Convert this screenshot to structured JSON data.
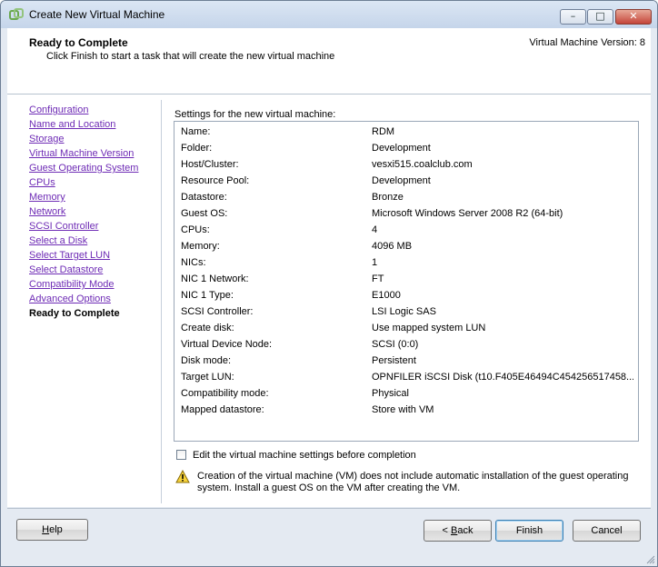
{
  "window": {
    "title": "Create New Virtual Machine",
    "buttons": {
      "minimize": "–",
      "maximize": "□",
      "close": "✕"
    }
  },
  "header": {
    "title": "Ready to Complete",
    "subtitle": "Click Finish to start a task that will create the new virtual machine",
    "version": "Virtual Machine Version: 8"
  },
  "nav": {
    "items": [
      {
        "label": "Configuration"
      },
      {
        "label": "Name and Location"
      },
      {
        "label": "Storage"
      },
      {
        "label": "Virtual Machine Version"
      },
      {
        "label": "Guest Operating System"
      },
      {
        "label": "CPUs"
      },
      {
        "label": "Memory"
      },
      {
        "label": "Network"
      },
      {
        "label": "SCSI Controller"
      },
      {
        "label": "Select a Disk"
      },
      {
        "label": "Select Target LUN"
      },
      {
        "label": "Select Datastore"
      },
      {
        "label": "Compatibility Mode"
      },
      {
        "label": "Advanced Options"
      },
      {
        "label": "Ready to Complete"
      }
    ],
    "current_index": 14
  },
  "settings": {
    "label": "Settings for the new virtual machine:",
    "rows": [
      {
        "key": "Name:",
        "value": "RDM"
      },
      {
        "key": "Folder:",
        "value": "Development"
      },
      {
        "key": "Host/Cluster:",
        "value": "vesxi515.coalclub.com"
      },
      {
        "key": "Resource Pool:",
        "value": "Development"
      },
      {
        "key": "Datastore:",
        "value": "Bronze"
      },
      {
        "key": "Guest OS:",
        "value": "Microsoft Windows Server 2008 R2 (64-bit)"
      },
      {
        "key": "CPUs:",
        "value": "4"
      },
      {
        "key": "Memory:",
        "value": "4096 MB"
      },
      {
        "key": "NICs:",
        "value": "1"
      },
      {
        "key": "NIC 1 Network:",
        "value": "FT"
      },
      {
        "key": "NIC 1 Type:",
        "value": "E1000"
      },
      {
        "key": "SCSI Controller:",
        "value": "LSI Logic SAS"
      },
      {
        "key": "Create disk:",
        "value": "Use mapped system LUN"
      },
      {
        "key": "Virtual Device Node:",
        "value": "SCSI (0:0)"
      },
      {
        "key": "Disk mode:",
        "value": "Persistent"
      },
      {
        "key": "Target LUN:",
        "value": "OPNFILER iSCSI Disk (t10.F405E46494C454256517458..."
      },
      {
        "key": "Compatibility mode:",
        "value": "Physical"
      },
      {
        "key": "Mapped datastore:",
        "value": "Store with VM"
      }
    ]
  },
  "edit_option": {
    "label": "Edit the virtual machine settings before completion",
    "checked": false
  },
  "warning": {
    "text": "Creation of the virtual machine (VM) does not include automatic installation of the guest operating system. Install a guest OS on the VM after creating the VM."
  },
  "footer": {
    "help": {
      "underline": "H",
      "rest": "elp"
    },
    "back": {
      "prefix": "< ",
      "underline": "B",
      "rest": "ack"
    },
    "finish": "Finish",
    "cancel": "Cancel"
  }
}
